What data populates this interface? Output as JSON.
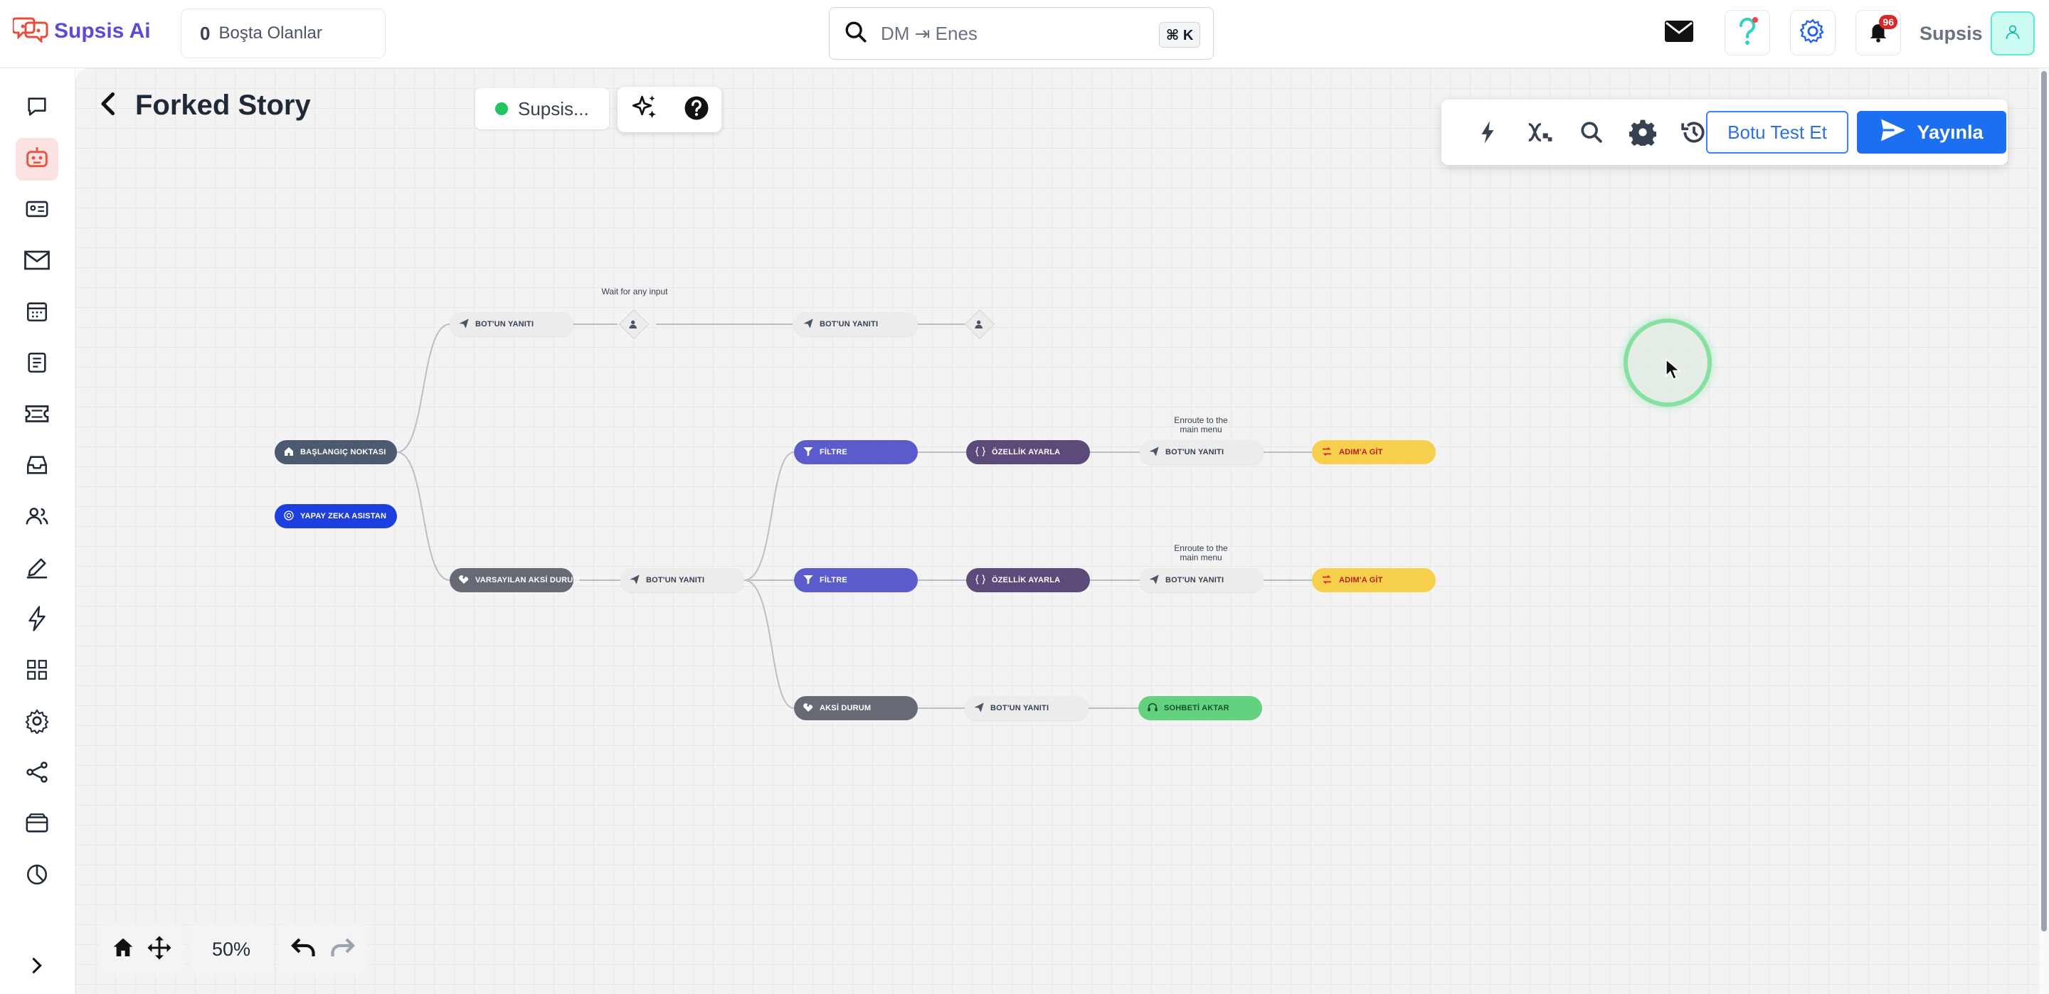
{
  "brand": {
    "name": "Supsis Ai",
    "accent": "#5b4ad6"
  },
  "idle": {
    "count": "0",
    "label": "Boşta Olanlar"
  },
  "search": {
    "placeholder": "DM ⇥ Enes",
    "shortcut": "⌘ K"
  },
  "header": {
    "notification_count": "96",
    "user_name": "Supsis"
  },
  "sidebar": {
    "items": [
      {
        "icon": "chat-bubble-icon"
      },
      {
        "icon": "robot-icon",
        "active": true
      },
      {
        "icon": "contact-card-icon"
      },
      {
        "icon": "mail-icon"
      },
      {
        "icon": "calendar-icon"
      },
      {
        "icon": "checklist-icon"
      },
      {
        "icon": "ticket-icon"
      },
      {
        "icon": "inbox-icon"
      },
      {
        "icon": "users-icon"
      },
      {
        "icon": "edit-icon"
      },
      {
        "icon": "lightning-icon"
      },
      {
        "icon": "grid-icon"
      },
      {
        "icon": "settings-icon"
      },
      {
        "icon": "share-icon"
      },
      {
        "icon": "wallet-icon"
      },
      {
        "icon": "pie-chart-icon"
      }
    ]
  },
  "page": {
    "title": "Forked Story",
    "status_label": "Supsis...",
    "status_color": "#22c55e"
  },
  "toolbar": {
    "test_label": "Botu Test Et",
    "publish_label": "Yayınla"
  },
  "flow": {
    "start": "BAŞLANGIÇ NOKTASI",
    "ai_assistant": "YAPAY ZEKA ASISTAN",
    "bot_reply": "BOT'UN YANITI",
    "wait_note": "Wait for any input",
    "default_error": "VARSAYILAN AKSİ DURUM",
    "filter": "FİLTRE",
    "set_property": "ÖZELLİK AYARLA",
    "enroute_note_1": "Enroute to the",
    "enroute_note_2": "main menu",
    "go_to_step": "ADIM'A GİT",
    "error": "AKSİ DURUM",
    "transfer_chat": "SOHBETİ AKTAR"
  },
  "bottom": {
    "zoom": "50%"
  }
}
